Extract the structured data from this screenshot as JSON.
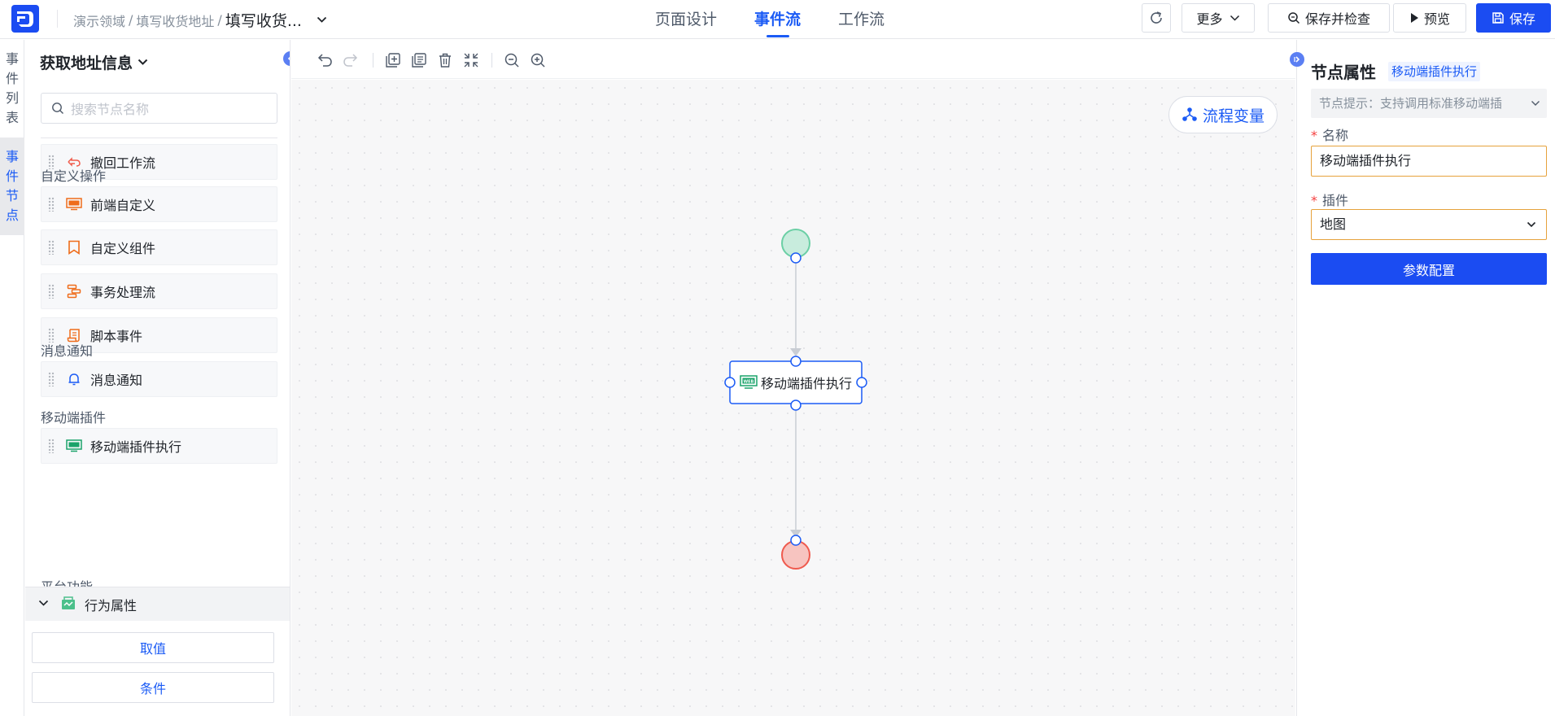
{
  "header": {
    "breadcrumb": [
      "演示领域",
      "填写收货地址",
      "填写收货..."
    ],
    "tabs": [
      {
        "label": "页面设计",
        "active": false
      },
      {
        "label": "事件流",
        "active": true
      },
      {
        "label": "工作流",
        "active": false
      }
    ],
    "buttons": {
      "more": "更多",
      "save_check": "保存并检查",
      "preview": "预览",
      "save": "保存"
    }
  },
  "side_tabs": [
    {
      "label": "事件列表",
      "active": false
    },
    {
      "label": "事件节点",
      "active": true
    }
  ],
  "left_panel": {
    "title": "获取地址信息",
    "search_placeholder": "搜索节点名称",
    "top_item": "撤回工作流",
    "groups": [
      {
        "label": "自定义操作",
        "items": [
          "前端自定义",
          "自定义组件",
          "事务处理流",
          "脚本事件"
        ]
      },
      {
        "label": "消息通知",
        "items": [
          "消息通知"
        ]
      },
      {
        "label": "移动端插件",
        "items": [
          "移动端插件执行"
        ]
      },
      {
        "label": "平台功能",
        "items": []
      }
    ],
    "behavior": {
      "title": "行为属性",
      "buttons": [
        "取值",
        "条件"
      ]
    }
  },
  "canvas": {
    "variables_button": "流程变量",
    "node_label": "移动端插件执行",
    "icon_text": "WEB"
  },
  "right_panel": {
    "title": "节点属性",
    "tag": "移动端插件执行",
    "hint": "节点提示：支持调用标准移动端插",
    "name_label": "名称",
    "name_value": "移动端插件执行",
    "plugin_label": "插件",
    "plugin_value": "地图",
    "config_button": "参数配置"
  },
  "colors": {
    "accent": "#1b5bf5",
    "primary_button": "#1b4cf2",
    "start_node": "#c8ecdd",
    "end_node": "#f7c4c0",
    "required": "#f53f3f",
    "field_border": "#e6a23c"
  }
}
